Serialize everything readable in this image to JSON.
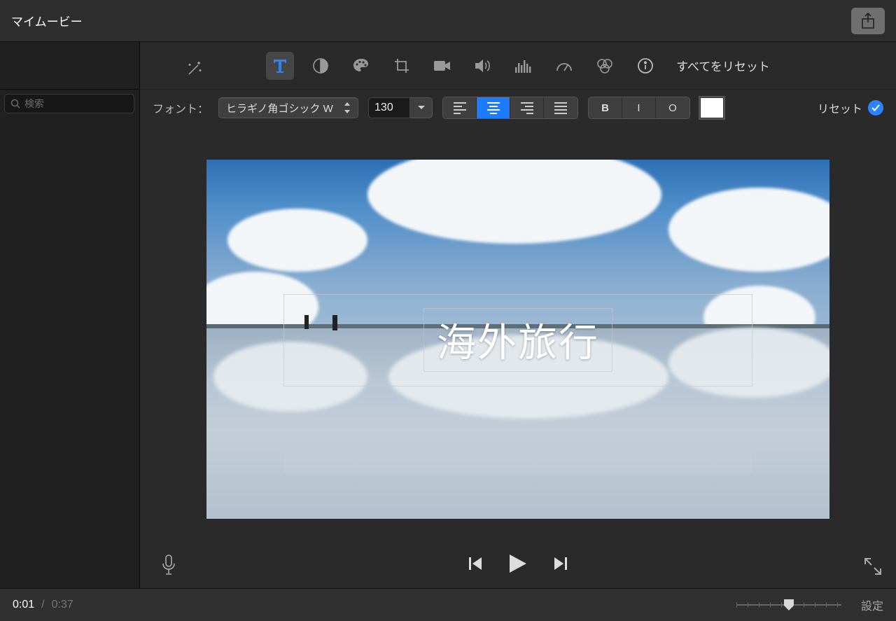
{
  "header": {
    "title": "マイムービー"
  },
  "sidebar": {
    "search_placeholder": "検索"
  },
  "toolbar": {
    "reset_all_label": "すべてをリセット"
  },
  "font_bar": {
    "font_label": "フォント：",
    "font_name": "ヒラギノ角ゴシック W",
    "size_value": "130",
    "reset_label": "リセット",
    "bold": "B",
    "italic": "I",
    "outline": "O"
  },
  "preview": {
    "title_text": "海外旅行"
  },
  "footer": {
    "current_time": "0:01",
    "separator": "/",
    "total_time": "0:37",
    "settings_label": "設定"
  }
}
